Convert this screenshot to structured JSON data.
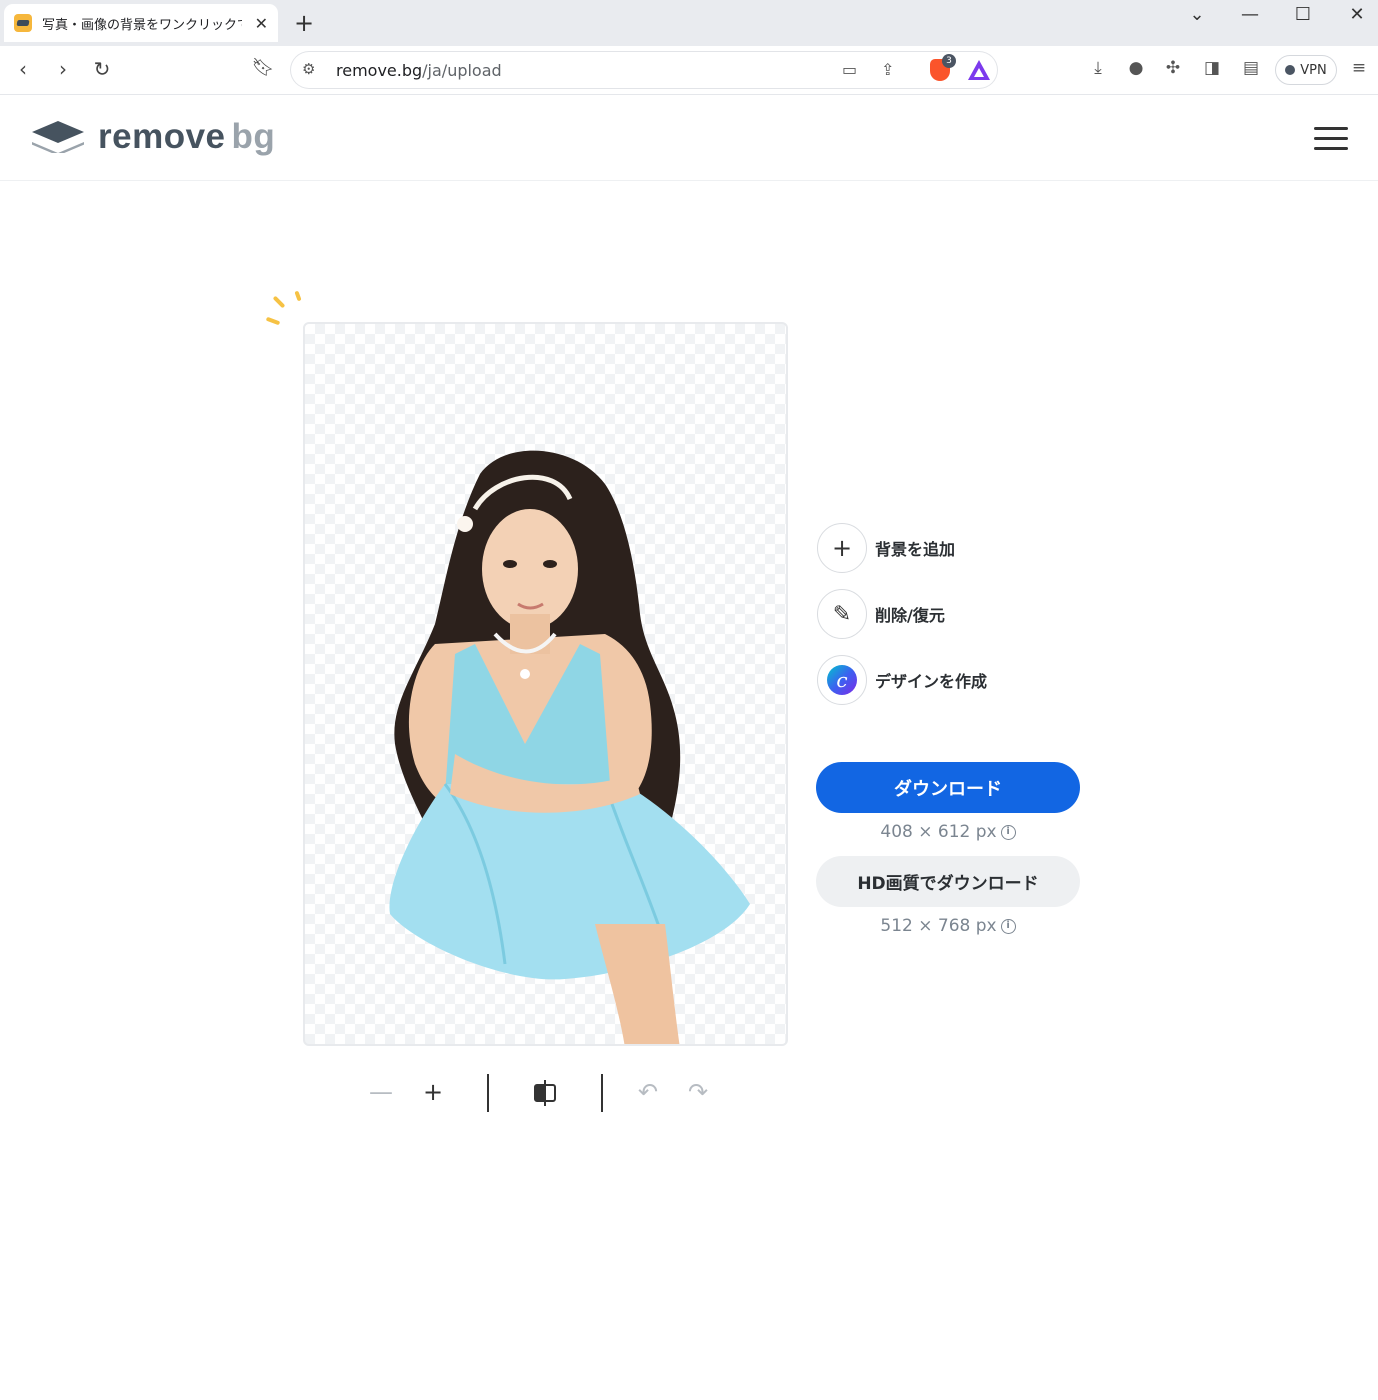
{
  "browser": {
    "tab_title": "写真・画像の背景をワンクリックで消",
    "tab_close": "✕",
    "new_tab": "+",
    "url_host": "remove.bg",
    "url_path": "/ja/upload",
    "brave_badge_count": "3",
    "vpn_label": "VPN",
    "window_controls": {
      "dropdown": "⌄",
      "minimize": "—",
      "maximize": "☐",
      "close": "✕"
    }
  },
  "site": {
    "logo_remove": "remove",
    "logo_bg": "bg"
  },
  "actions": [
    {
      "icon": "plus-icon",
      "label": "背景を追加"
    },
    {
      "icon": "magic-brush-icon",
      "label": "削除/復元"
    },
    {
      "icon": "canva-icon",
      "label": "デザインを作成"
    }
  ],
  "download": {
    "primary_label": "ダウンロード",
    "primary_res": "408 × 612 px",
    "hd_label": "HD画質でダウンロード",
    "hd_res": "512 × 768 px",
    "info_glyph": "i"
  },
  "tools": {
    "zoom_out": "—",
    "zoom_in": "+",
    "undo": "↶",
    "redo": "↷"
  },
  "colors": {
    "accent": "#1266e3",
    "logo_dark": "#46535f",
    "logo_light": "#9aa3ab",
    "spark": "#f6c244"
  }
}
